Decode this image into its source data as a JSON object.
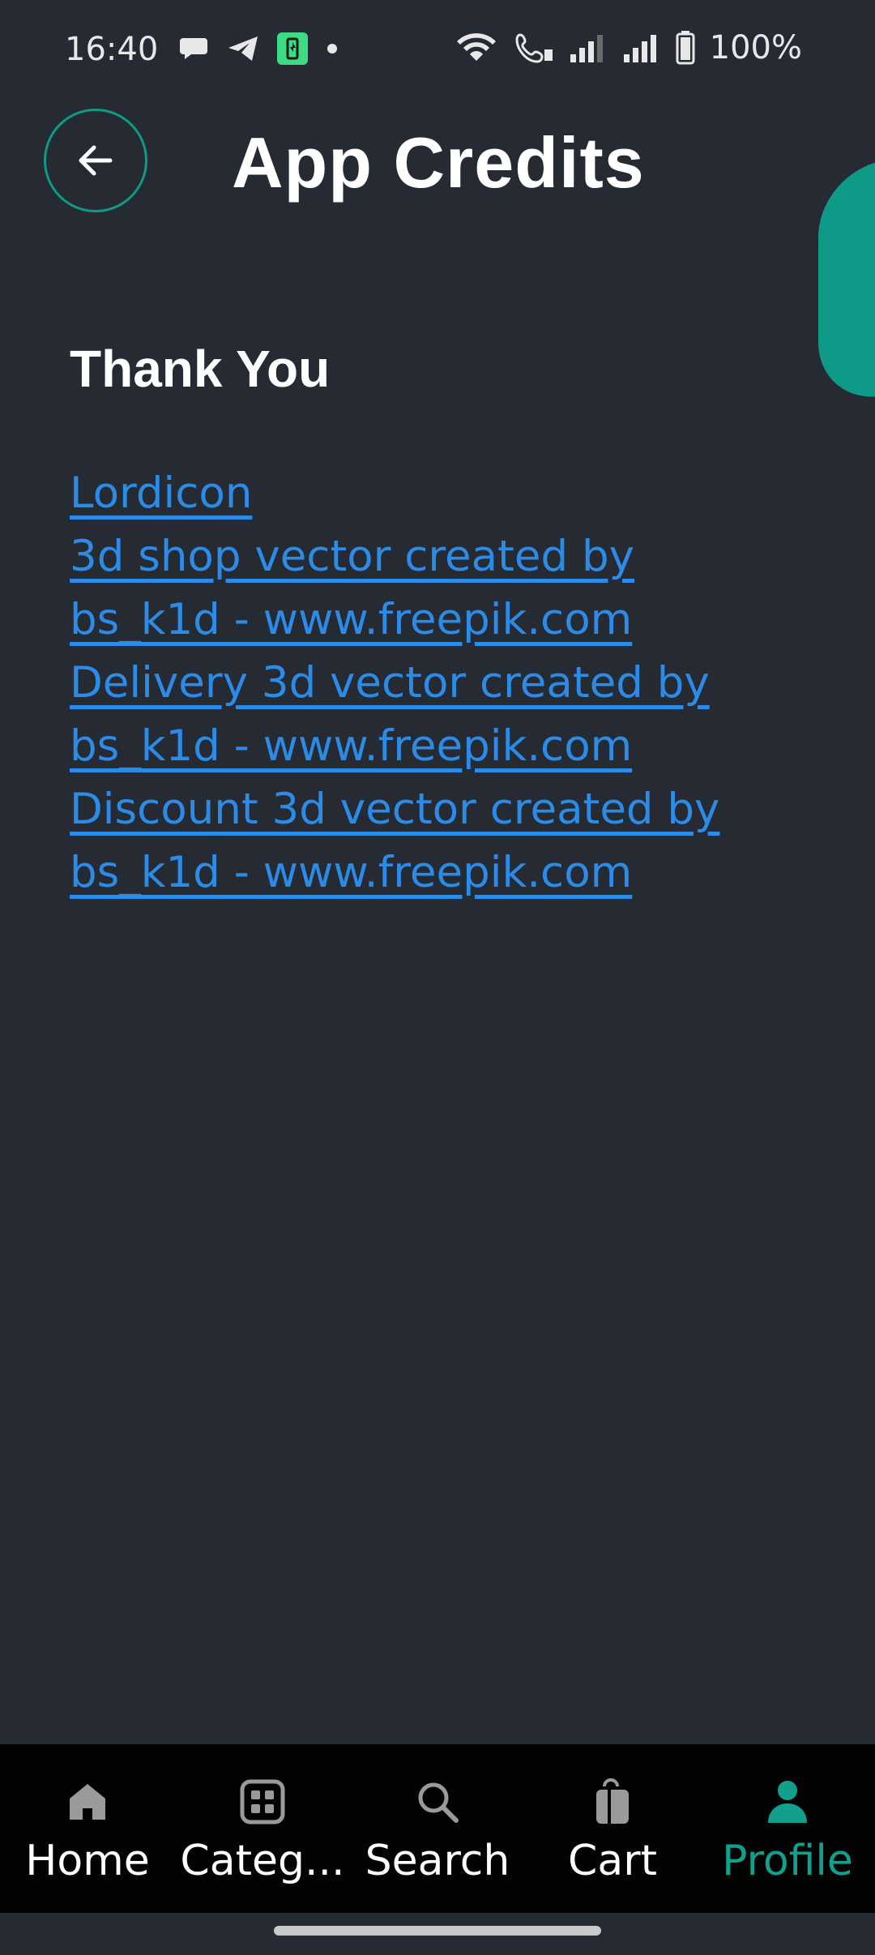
{
  "status_bar": {
    "time": "16:40",
    "battery_text": "100%"
  },
  "header": {
    "title": "App Credits"
  },
  "section": {
    "title": "Thank You"
  },
  "credits": [
    "Lordicon",
    "3d shop vector created by",
    "bs_k1d - www.freepik.com",
    "Delivery 3d vector created by",
    "bs_k1d - www.freepik.com",
    "Discount 3d vector created by",
    "bs_k1d - www.freepik.com"
  ],
  "bottom_nav": {
    "items": [
      {
        "label": "Home",
        "icon": "home-icon"
      },
      {
        "label": "Categ...",
        "icon": "categories-icon"
      },
      {
        "label": "Search",
        "icon": "search-icon"
      },
      {
        "label": "Cart",
        "icon": "cart-icon"
      },
      {
        "label": "Profile",
        "icon": "profile-icon"
      }
    ],
    "active_index": 4
  },
  "colors": {
    "background": "#252a33",
    "accent": "#0f9a87",
    "link": "#2b8be6",
    "nav_background": "#030303"
  }
}
